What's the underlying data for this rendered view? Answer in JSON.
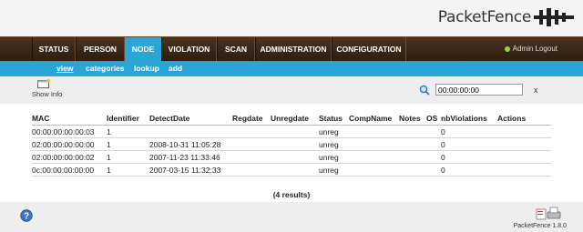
{
  "app": {
    "logo_text": "PacketFence",
    "version": "PacketFence 1.8.0"
  },
  "nav": {
    "items": [
      "STATUS",
      "PERSON",
      "NODE",
      "VIOLATION",
      "SCAN",
      "ADMINISTRATION",
      "CONFIGURATION"
    ],
    "active": "NODE",
    "user_label": "Admin Logout"
  },
  "subnav": {
    "items": [
      "view",
      "categories",
      "lookup",
      "add"
    ],
    "active": "view"
  },
  "toolbar": {
    "show_info_label": "Show Info",
    "search_value": "00:00:00:00",
    "clear_label": "x"
  },
  "table": {
    "columns": [
      "MAC",
      "Identifier",
      "DetectDate",
      "Regdate",
      "Unregdate",
      "Status",
      "CompName",
      "Notes",
      "OS",
      "nbViolations",
      "Actions"
    ],
    "rows": [
      [
        "00:00:00:00:00:03",
        "1",
        "",
        "",
        "",
        "unreg",
        "",
        "",
        "",
        "0",
        ""
      ],
      [
        "02:00:00:00:00:00",
        "1",
        "2008-10-31 11:05:28",
        "",
        "",
        "unreg",
        "",
        "",
        "",
        "0",
        ""
      ],
      [
        "02:00:00:00:00:02",
        "1",
        "2007-11-23 11:33:46",
        "",
        "",
        "unreg",
        "",
        "",
        "",
        "0",
        ""
      ],
      [
        "0c:00:00:00:00:00",
        "1",
        "2007-03-15 11:32:33",
        "",
        "",
        "unreg",
        "",
        "",
        "",
        "0",
        ""
      ]
    ]
  },
  "results_label": "(4 results)",
  "colors": {
    "nav_bg": "#3a2716",
    "accent": "#29a6d6",
    "toolbar_bg": "#eeeeee"
  }
}
